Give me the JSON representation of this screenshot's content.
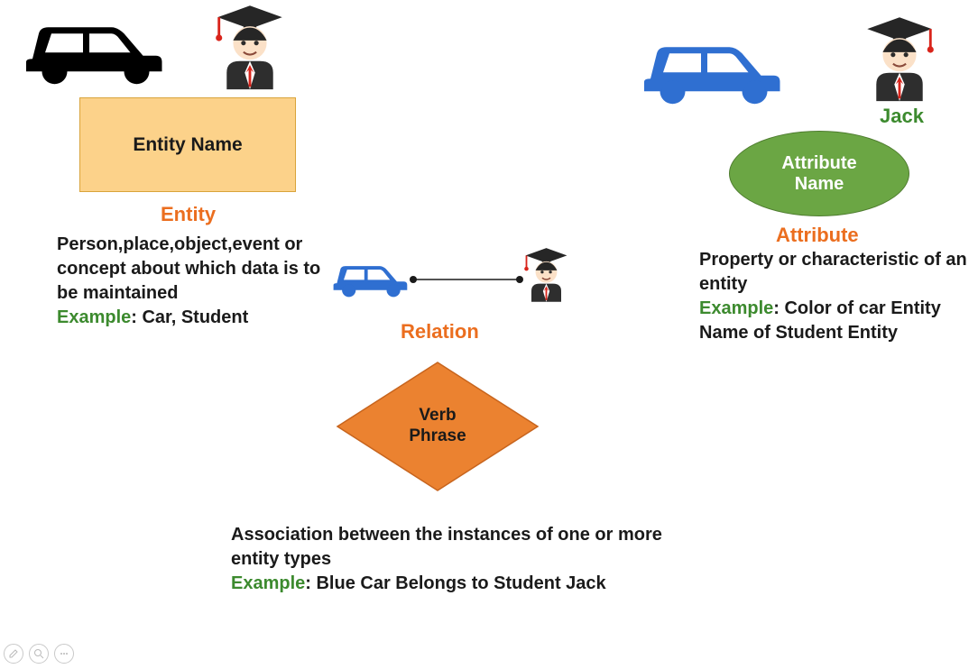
{
  "entity": {
    "box_label": "Entity Name",
    "heading": "Entity",
    "desc": "Person,place,object,event or concept about which data is to be maintained",
    "example_label": "Example",
    "example_text": ": Car, Student"
  },
  "relation": {
    "diamond_label": "Verb\nPhrase",
    "heading": "Relation",
    "desc": "Association between the instances of one or more entity types",
    "example_label": "Example",
    "example_text": ": Blue Car Belongs to Student Jack"
  },
  "attribute": {
    "ellipse_label": "Attribute\nName",
    "heading": "Attribute",
    "jack_label": "Jack",
    "desc": "Property or characteristic of an entity",
    "example_label": "Example",
    "example_text": ": Color of car Entity Name of Student Entity"
  }
}
